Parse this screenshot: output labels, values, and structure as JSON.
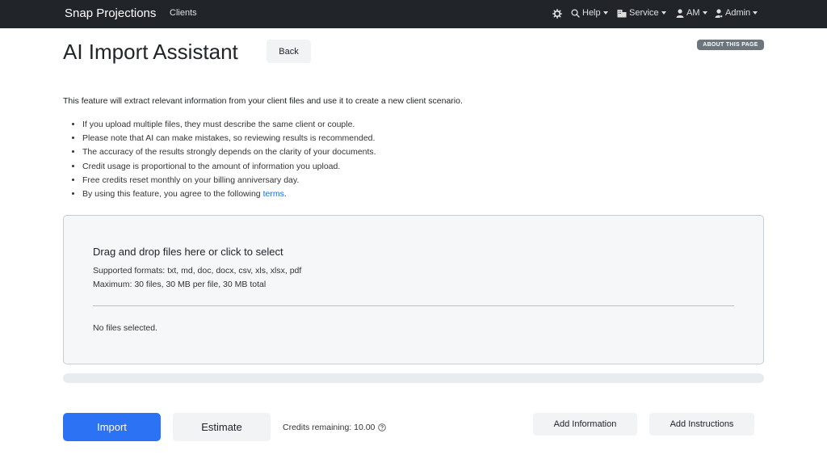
{
  "navbar": {
    "brand": "Snap Projections",
    "clients": "Clients",
    "help": "Help",
    "service": "Service",
    "user": "AM",
    "admin": "Admin"
  },
  "header": {
    "title": "AI Import Assistant",
    "back_label": "Back",
    "about_label": "ABOUT THIS PAGE"
  },
  "intro": "This feature will extract relevant information from your client files and use it to create a new client scenario.",
  "bullets": [
    "If you upload multiple files, they must describe the same client or couple.",
    "Please note that AI can make mistakes, so reviewing results is recommended.",
    "The accuracy of the results strongly depends on the clarity of your documents.",
    "Credit usage is proportional to the amount of information you upload.",
    "Free credits reset monthly on your billing anniversary day."
  ],
  "terms_bullet": {
    "prefix": "By using this feature, you agree to the following ",
    "link": "terms",
    "suffix": "."
  },
  "dropzone": {
    "title": "Drag and drop files here or click to select",
    "formats": "Supported formats: txt, md, doc, docx, csv, xls, xlsx, pdf",
    "maximum": "Maximum: 30 files, 30 MB per file, 30 MB total",
    "status": "No files selected."
  },
  "progress": {
    "percent": 0
  },
  "actions": {
    "import_label": "Import",
    "estimate_label": "Estimate",
    "credits_text": "Credits remaining: 10.00",
    "add_information_label": "Add Information",
    "add_instructions_label": "Add Instructions"
  },
  "icons": {
    "settings": "gear-icon",
    "help": "search-icon",
    "service": "building-icon",
    "user": "person-icon",
    "admin": "admin-person-icon",
    "credits_help": "question-circle-icon"
  },
  "colors": {
    "navbar": "#212529",
    "primary": "#2b72f5",
    "link": "#0d6efd",
    "badge": "#6c757d"
  }
}
